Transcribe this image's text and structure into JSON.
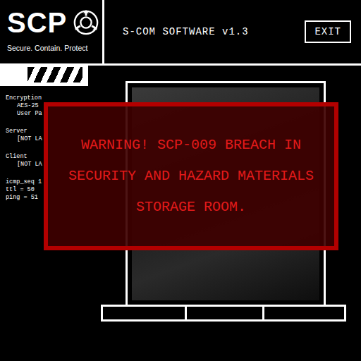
{
  "logo": {
    "title": "SCP",
    "tagline": "Secure. Contain. Protect"
  },
  "header": {
    "title": "S-COM SOFTWARE v1.3",
    "exit_button": "EXIT"
  },
  "sidebar": {
    "lines": [
      {
        "text": "Encryption",
        "kind": "label"
      },
      {
        "text": "AES-25",
        "kind": "value"
      },
      {
        "text": "User Pa",
        "kind": "value"
      },
      {
        "text": "Server",
        "kind": "label"
      },
      {
        "text": "[NOT LA",
        "kind": "value"
      },
      {
        "text": "Client",
        "kind": "label"
      },
      {
        "text": "[NOT LA",
        "kind": "value"
      },
      {
        "text": "icmp_seq 1",
        "kind": "label"
      },
      {
        "text": "ttl = 50",
        "kind": "label"
      },
      {
        "text": "ping = 51",
        "kind": "label"
      }
    ]
  },
  "alert": {
    "message": "WARNING! SCP-009 BREACH IN SECURITY AND HAZARD MATERIALS STORAGE ROOM."
  }
}
